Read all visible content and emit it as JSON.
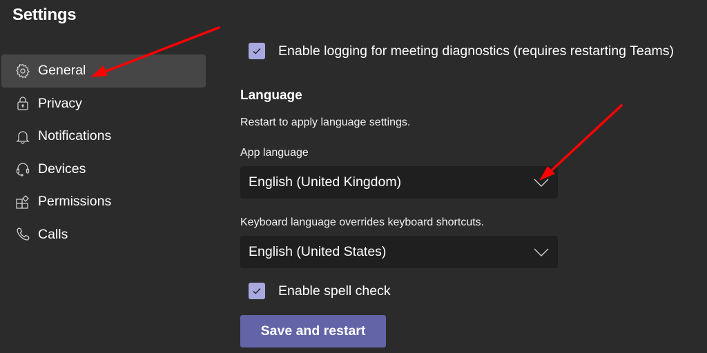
{
  "page": {
    "title": "Settings"
  },
  "sidebar": {
    "items": [
      {
        "label": "General",
        "icon": "gear-icon",
        "active": true
      },
      {
        "label": "Privacy",
        "icon": "lock-icon",
        "active": false
      },
      {
        "label": "Notifications",
        "icon": "bell-icon",
        "active": false
      },
      {
        "label": "Devices",
        "icon": "headset-icon",
        "active": false
      },
      {
        "label": "Permissions",
        "icon": "apps-icon",
        "active": false
      },
      {
        "label": "Calls",
        "icon": "phone-icon",
        "active": false
      }
    ]
  },
  "general": {
    "logging_checkbox": {
      "label": "Enable logging for meeting diagnostics (requires restarting Teams)",
      "checked": true
    },
    "language": {
      "heading": "Language",
      "note": "Restart to apply language settings.",
      "app_language_label": "App language",
      "app_language_value": "English (United Kingdom)",
      "keyboard_label": "Keyboard language overrides keyboard shortcuts.",
      "keyboard_value": "English (United States)",
      "spellcheck_checkbox": {
        "label": "Enable spell check",
        "checked": true
      },
      "save_button": "Save and restart"
    }
  },
  "colors": {
    "background": "#2b2b2b",
    "active_nav": "#464646",
    "checkbox": "#a9a8e0",
    "select_bg": "#1f1f1f",
    "button": "#6264a7",
    "annotation_arrow": "#ff0000"
  }
}
